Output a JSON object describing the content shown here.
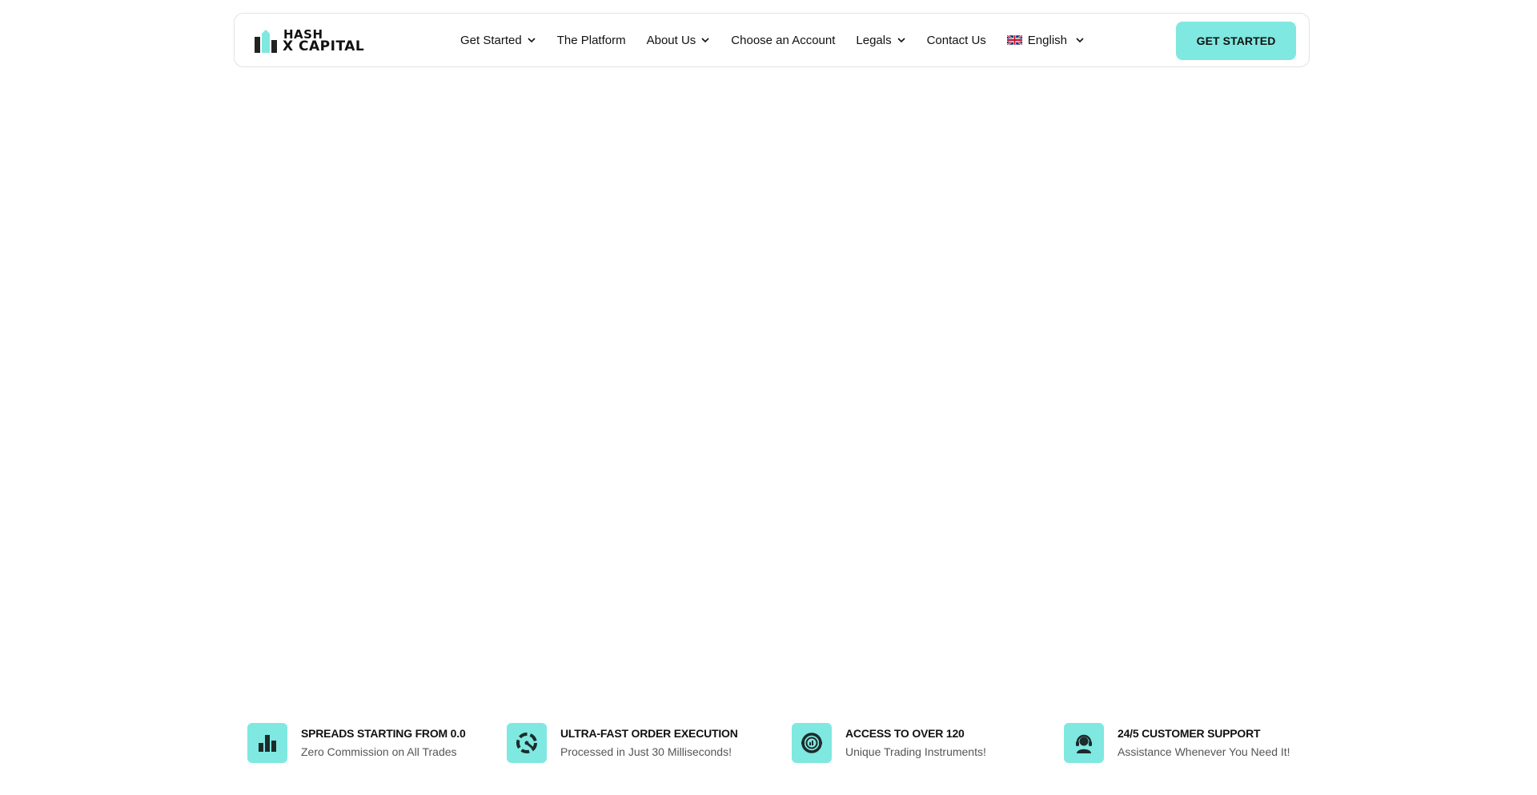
{
  "brand": {
    "logo_line1": "HASH",
    "logo_line2": "X CAPITAL",
    "accent_color": "#7fe8e0"
  },
  "nav": {
    "items": [
      {
        "label": "Get Started",
        "has_dropdown": true
      },
      {
        "label": "The Platform",
        "has_dropdown": false
      },
      {
        "label": "About Us",
        "has_dropdown": true
      },
      {
        "label": "Choose an Account",
        "has_dropdown": false
      },
      {
        "label": "Legals",
        "has_dropdown": true
      },
      {
        "label": "Contact Us",
        "has_dropdown": false
      }
    ],
    "language": {
      "label": "English",
      "flag_icon": "uk-flag-icon"
    }
  },
  "header": {
    "cta_label": "GET STARTED"
  },
  "features": [
    {
      "icon": "bar-chart-icon",
      "title": "SPREADS STARTING FROM 0.0",
      "subtitle": "Zero Commission on All Trades"
    },
    {
      "icon": "speedometer-icon",
      "title": "ULTRA-FAST ORDER EXECUTION",
      "subtitle": "Processed in Just 30 Milliseconds!"
    },
    {
      "icon": "target-chart-icon",
      "title": "ACCESS TO OVER 120",
      "subtitle": "Unique Trading Instruments!"
    },
    {
      "icon": "headset-support-icon",
      "title": "24/5 CUSTOMER SUPPORT",
      "subtitle": "Assistance Whenever You Need It!"
    }
  ]
}
